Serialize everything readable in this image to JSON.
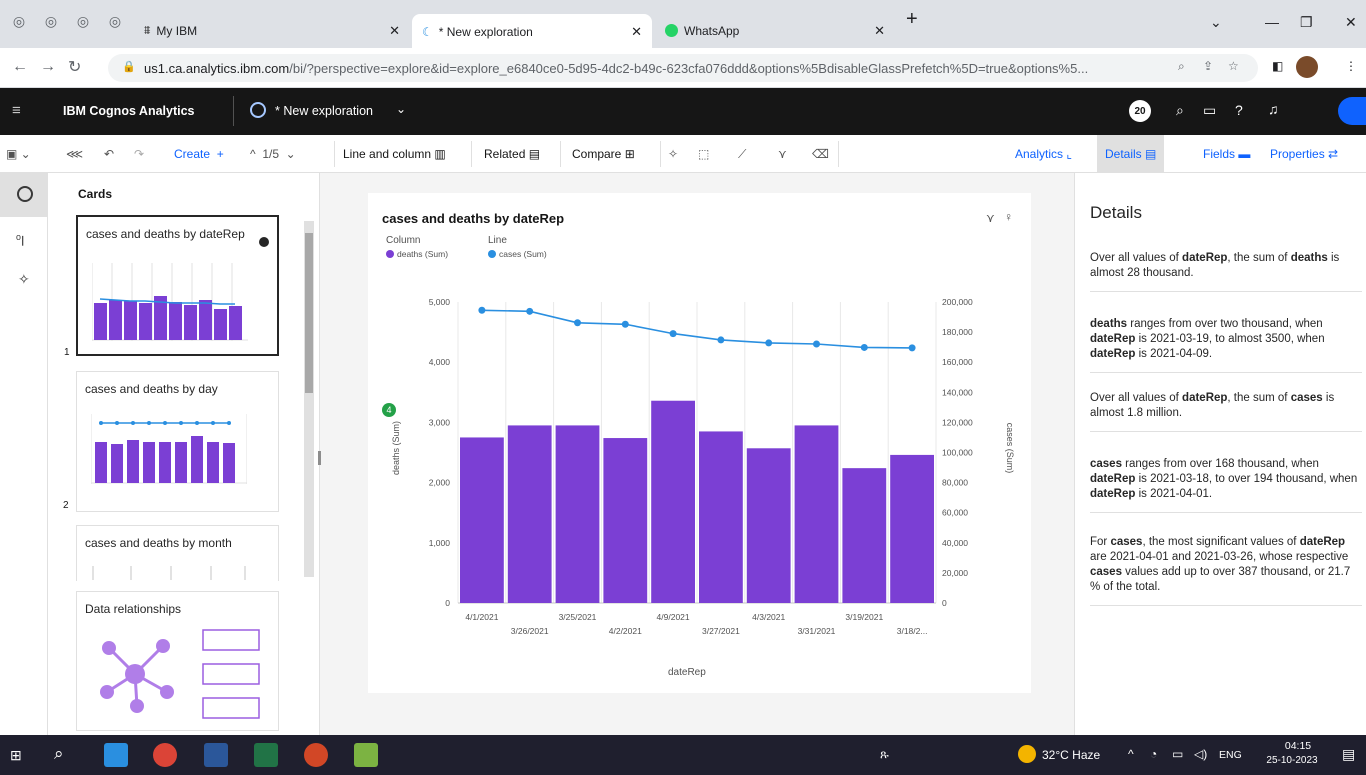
{
  "browser": {
    "tabs": [
      {
        "label": "My IBM"
      },
      {
        "label": "* New exploration"
      },
      {
        "label": "WhatsApp"
      }
    ],
    "new_tab": "+",
    "url_host": "us1.ca.analytics.ibm.com",
    "url_rest": "/bi/?perspective=explore&id=explore_e6840ce0-5d95-4dc2-b49c-623cfa076ddd&options%5BdisableGlassPrefetch%5D=true&options%5..."
  },
  "app": {
    "name": "IBM Cognos Analytics",
    "exploration_title": "* New exploration",
    "notification_count": "20"
  },
  "toolbar": {
    "create": "Create",
    "page_indicator": "1/5",
    "viz_type": "Line and column",
    "related": "Related",
    "compare": "Compare",
    "analytics": "Analytics",
    "details": "Details",
    "fields": "Fields",
    "properties": "Properties"
  },
  "cards_panel": {
    "title": "Cards",
    "cards": [
      {
        "title": "cases and deaths by dateRep",
        "index": "1"
      },
      {
        "title": "cases and deaths by day",
        "index": "2"
      },
      {
        "title": "cases and deaths by month",
        "index": ""
      }
    ],
    "relationships_title": "Data relationships"
  },
  "chart_data": {
    "type": "bar",
    "title": "cases and deaths by dateRep",
    "legend": [
      {
        "group": "Column",
        "label": "deaths (Sum)",
        "color": "#7b3fd4"
      },
      {
        "group": "Line",
        "label": "cases (Sum)",
        "color": "#2a8fe0"
      }
    ],
    "categories": [
      "4/1/2021",
      "3/26/2021",
      "3/25/2021",
      "4/2/2021",
      "4/9/2021",
      "3/27/2021",
      "4/3/2021",
      "3/31/2021",
      "3/19/2021",
      "3/18/2..."
    ],
    "series": [
      {
        "name": "deaths (Sum)",
        "axis": "left",
        "kind": "column",
        "values": [
          2750,
          2950,
          2950,
          2740,
          3360,
          2850,
          2570,
          2950,
          2240,
          2460
        ]
      },
      {
        "name": "cases (Sum)",
        "axis": "right",
        "kind": "line",
        "values": [
          194500,
          193800,
          186200,
          185200,
          179000,
          174800,
          172800,
          172100,
          169800,
          169500
        ]
      }
    ],
    "left_axis": {
      "label": "deaths (Sum)",
      "ticks": [
        "0",
        "1,000",
        "2,000",
        "3,000",
        "4,000",
        "5,000"
      ],
      "range": [
        0,
        5000
      ]
    },
    "right_axis": {
      "label": "cases (Sum)",
      "ticks": [
        "0",
        "20,000",
        "40,000",
        "60,000",
        "80,000",
        "100,000",
        "120,000",
        "140,000",
        "160,000",
        "180,000",
        "200,000"
      ],
      "range": [
        0,
        200000
      ]
    },
    "x_label": "dateRep",
    "badge": "4"
  },
  "details": {
    "title": "Details",
    "paragraphs": [
      "Over all values of dateRep, the sum of deaths is almost 28 thousand.",
      "deaths ranges from over two thousand, when dateRep is 2021-03-19, to almost 3500, when dateRep is 2021-04-09.",
      "Over all values of dateRep, the sum of cases is almost 1.8 million.",
      "cases ranges from over 168 thousand, when dateRep is 2021-03-18, to over 194 thousand, when dateRep is 2021-04-01.",
      "For cases, the most significant values of dateRep are 2021-04-01 and 2021-03-26, whose respective cases values add up to over 387 thousand, or 21.7 % of the total."
    ]
  },
  "taskbar": {
    "weather": "32°C  Haze",
    "lang": "ENG",
    "time": "04:15",
    "date": "25-10-2023"
  },
  "colors": {
    "bar": "#7b3fd4",
    "line": "#2a8fe0",
    "accent": "#0f62fe"
  }
}
